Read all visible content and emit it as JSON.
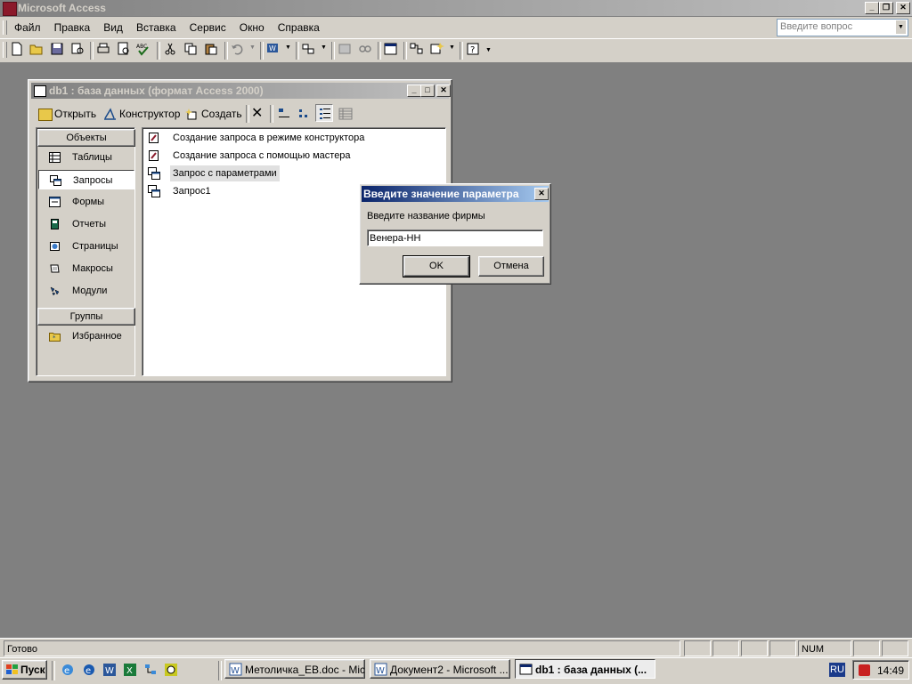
{
  "app": {
    "title": "Microsoft Access",
    "help_placeholder": "Введите вопрос"
  },
  "menu": [
    "Файл",
    "Правка",
    "Вид",
    "Вставка",
    "Сервис",
    "Окно",
    "Справка"
  ],
  "db_window": {
    "title": "db1 : база данных (формат Access 2000)",
    "toolbar": {
      "open": "Открыть",
      "design": "Конструктор",
      "create": "Создать"
    },
    "objects_header": "Объекты",
    "objects": [
      "Таблицы",
      "Запросы",
      "Формы",
      "Отчеты",
      "Страницы",
      "Макросы",
      "Модули"
    ],
    "groups_header": "Группы",
    "groups": [
      "Избранное"
    ],
    "items": [
      "Создание запроса в режиме конструктора",
      "Создание запроса с помощью мастера",
      "Запрос с параметрами",
      "Запрос1"
    ]
  },
  "dialog": {
    "title": "Введите значение параметра",
    "prompt": "Введите название фирмы",
    "value": "Венера-НН",
    "ok": "OK",
    "cancel": "Отмена"
  },
  "status": {
    "text": "Готово",
    "num": "NUM"
  },
  "taskbar": {
    "start": "Пуск",
    "tasks": [
      "Метоличка_ЕВ.doc - Mic...",
      "Документ2 - Microsoft ...",
      "db1 : база данных (..."
    ],
    "lang": "RU",
    "clock": "14:49"
  },
  "colors": {
    "desktop": "#808080",
    "face": "#d4d0c8",
    "active_title": "#0a246a",
    "selection": "#0a246a"
  }
}
